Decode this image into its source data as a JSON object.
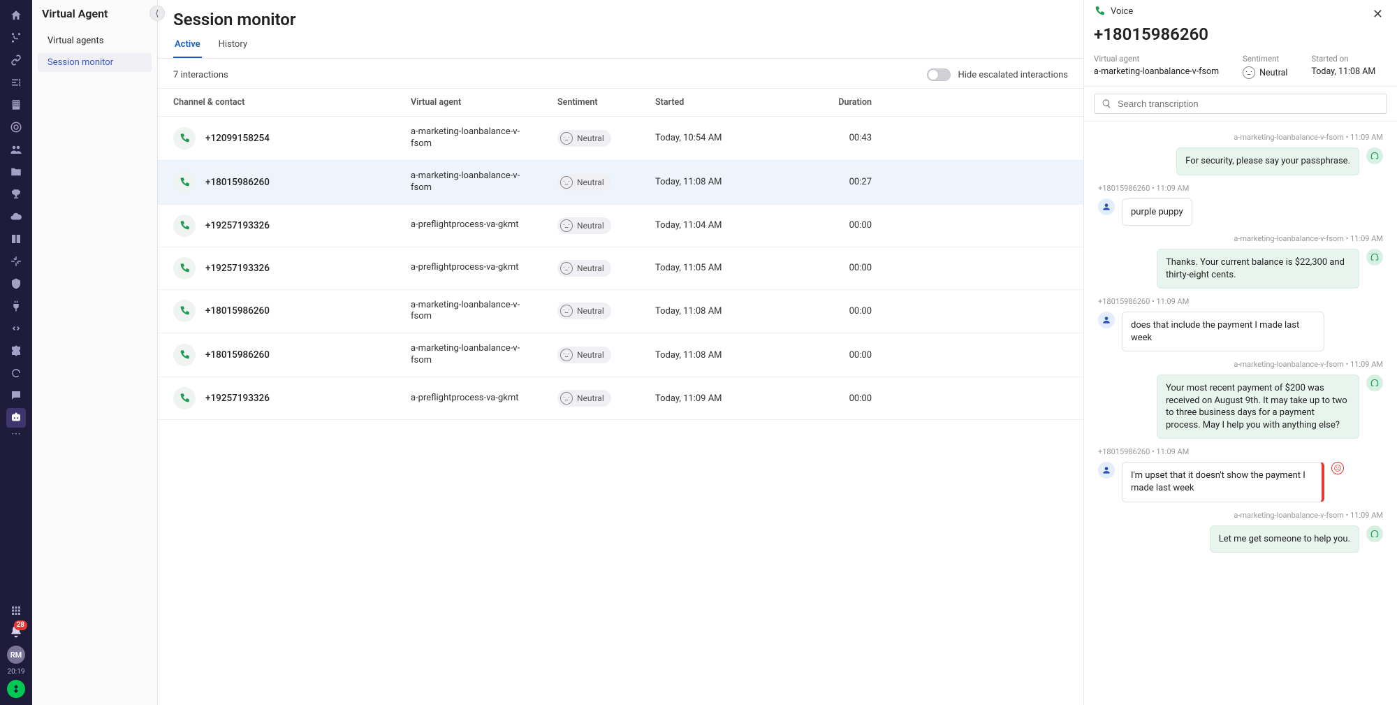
{
  "rail": {
    "notification_count": "28",
    "avatar_initials": "RM",
    "time": "20:19"
  },
  "sidenav": {
    "title": "Virtual Agent",
    "items": [
      {
        "label": "Virtual agents"
      },
      {
        "label": "Session monitor",
        "active": true
      }
    ]
  },
  "page": {
    "title": "Session monitor",
    "tabs": [
      {
        "label": "Active",
        "active": true
      },
      {
        "label": "History"
      }
    ],
    "count_text": "7 interactions",
    "hide_toggle_label": "Hide escalated interactions",
    "columns": {
      "channel": "Channel & contact",
      "agent": "Virtual agent",
      "sentiment": "Sentiment",
      "started": "Started",
      "duration": "Duration"
    },
    "rows": [
      {
        "contact": "+12099158254",
        "agent": "a-marketing-loanbalance-v-fsom",
        "sentiment": "Neutral",
        "started": "Today, 10:54 AM",
        "duration": "00:43"
      },
      {
        "contact": "+18015986260",
        "agent": "a-marketing-loanbalance-v-fsom",
        "sentiment": "Neutral",
        "started": "Today, 11:08 AM",
        "duration": "00:27",
        "selected": true
      },
      {
        "contact": "+19257193326",
        "agent": "a-preflightprocess-va-gkmt",
        "sentiment": "Neutral",
        "started": "Today, 11:04 AM",
        "duration": "00:00"
      },
      {
        "contact": "+19257193326",
        "agent": "a-preflightprocess-va-gkmt",
        "sentiment": "Neutral",
        "started": "Today, 11:05 AM",
        "duration": "00:00"
      },
      {
        "contact": "+18015986260",
        "agent": "a-marketing-loanbalance-v-fsom",
        "sentiment": "Neutral",
        "started": "Today, 11:08 AM",
        "duration": "00:00"
      },
      {
        "contact": "+18015986260",
        "agent": "a-marketing-loanbalance-v-fsom",
        "sentiment": "Neutral",
        "started": "Today, 11:08 AM",
        "duration": "00:00"
      },
      {
        "contact": "+19257193326",
        "agent": "a-preflightprocess-va-gkmt",
        "sentiment": "Neutral",
        "started": "Today, 11:09 AM",
        "duration": "00:00"
      }
    ]
  },
  "panel": {
    "channel_label": "Voice",
    "number": "+18015986260",
    "meta": {
      "va_label": "Virtual agent",
      "va_value": "a-marketing-loanbalance-v-fsom",
      "sent_label": "Sentiment",
      "sent_value": "Neutral",
      "started_label": "Started on",
      "started_value": "Today, 11:08 AM"
    },
    "search_placeholder": "Search transcription",
    "messages": [
      {
        "side": "agent",
        "meta": "a-marketing-loanbalance-v-fsom • 11:09 AM",
        "text": "For security, please say your passphrase."
      },
      {
        "side": "user",
        "meta": "+18015986260 • 11:09 AM",
        "text": "purple puppy"
      },
      {
        "side": "agent",
        "meta": "a-marketing-loanbalance-v-fsom • 11:09 AM",
        "text": "Thanks. Your current balance is $22,300 and thirty-eight cents."
      },
      {
        "side": "user",
        "meta": "+18015986260 • 11:09 AM",
        "text": "does that include the payment I made last week"
      },
      {
        "side": "agent",
        "meta": "a-marketing-loanbalance-v-fsom • 11:09 AM",
        "text": "Your most recent payment of $200 was received on August 9th. It may take up to two to three business days for a payment process. May I help you with anything else?"
      },
      {
        "side": "user",
        "meta": "+18015986260 • 11:09 AM",
        "text": "I'm upset that it doesn't show the payment I made last week",
        "negative": true
      },
      {
        "side": "agent",
        "meta": "a-marketing-loanbalance-v-fsom • 11:09 AM",
        "text": "Let me get someone to help you."
      }
    ]
  }
}
